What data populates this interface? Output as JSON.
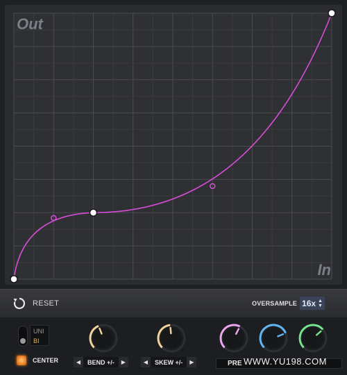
{
  "graph": {
    "out_label": "Out",
    "in_label": "In",
    "curve_color": "#d84dd8",
    "grid_divisions": 8,
    "curve_points": [
      {
        "in": 0.0,
        "out": 0.0,
        "type": "anchor"
      },
      {
        "in": 0.125,
        "out": 0.23,
        "type": "handle"
      },
      {
        "in": 0.25,
        "out": 0.25,
        "type": "anchor"
      },
      {
        "in": 0.625,
        "out": 0.35,
        "type": "handle"
      },
      {
        "in": 1.0,
        "out": 1.0,
        "type": "anchor"
      }
    ]
  },
  "toolbar": {
    "reset_label": "RESET",
    "oversample_label": "OVERSAMPLE",
    "oversample_value": "16x"
  },
  "controls": {
    "polarity": {
      "uni_label": "UNI",
      "bi_label": "BI",
      "selected": "BI"
    },
    "center_label": "CENTER",
    "bend_label": "BEND +/-",
    "skew_label": "SKEW +/-",
    "pre_label": "PRE",
    "watermark": "WWW.YU198.COM",
    "knobs": [
      {
        "name": "bend",
        "color": "#f2d49a",
        "value": 0.42
      },
      {
        "name": "skew",
        "color": "#f2d49a",
        "value": 0.48
      },
      {
        "name": "pink",
        "color": "#eba6ee",
        "value": 0.6
      },
      {
        "name": "blue",
        "color": "#61b6f2",
        "value": 0.75
      },
      {
        "name": "green",
        "color": "#74e58d",
        "value": 0.68
      }
    ]
  }
}
